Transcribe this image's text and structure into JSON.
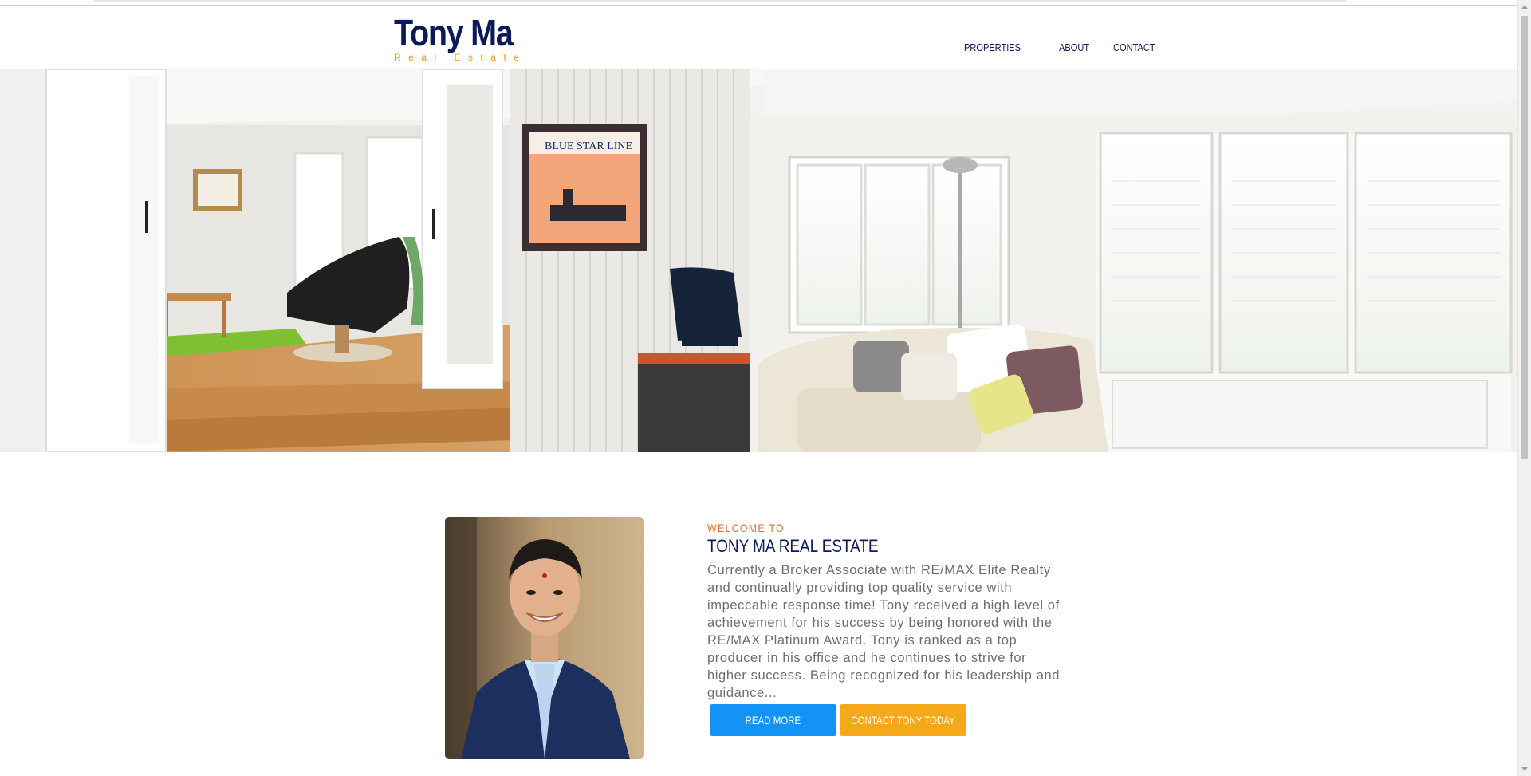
{
  "brand": {
    "name": "Tony Ma",
    "tagline": "Real Estate",
    "primary_color": "#0d1a5a",
    "accent_color": "#f39c12"
  },
  "nav": {
    "items": [
      {
        "label": "PROPERTIES"
      },
      {
        "label": "ABOUT"
      },
      {
        "label": "CONTACT"
      }
    ]
  },
  "hero": {
    "image": "bright living room interior with white shutters, sofa, desk and armchair",
    "poster_text": "BLUE STAR LINE"
  },
  "welcome": {
    "eyebrow": "WELCOME TO",
    "title": "TONY MA REAL ESTATE",
    "body": "Currently a Broker Associate with RE/MAX Elite Realty and continually providing top quality service with impeccable response time! Tony received a high level of achievement for his success by being honored with the RE/MAX Platinum Award. Tony is ranked as a top producer in his office and he continues to strive for higher success. Being recognized for his leadership and guidance...",
    "portrait": "headshot of smiling man in navy blazer"
  },
  "buttons": {
    "read_more": "READ MORE",
    "read_more_color": "#1493f6",
    "contact": "CONTACT TONY TODAY",
    "contact_color": "#f6a81b"
  }
}
